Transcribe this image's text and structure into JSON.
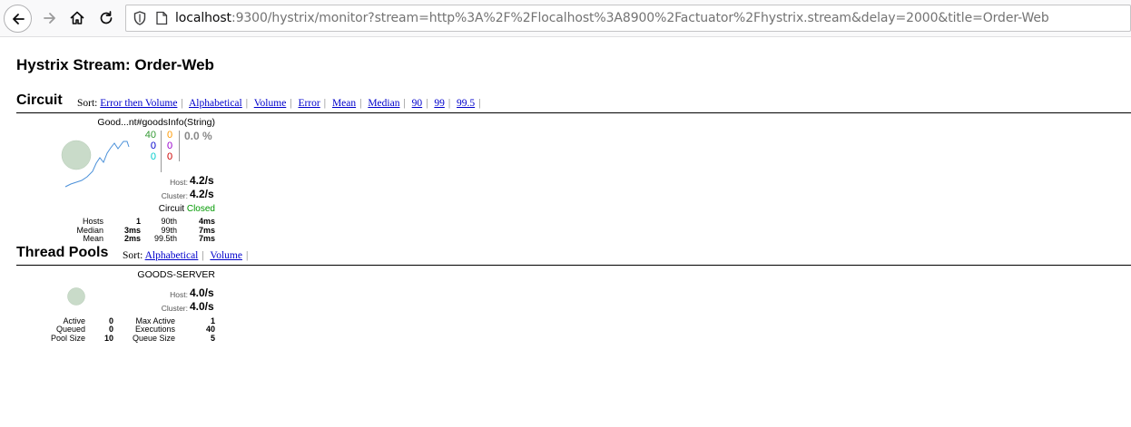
{
  "browser": {
    "url_host": "localhost",
    "url_rest": ":9300/hystrix/monitor?stream=http%3A%2F%2Flocalhost%3A8900%2Factuator%2Fhystrix.stream&delay=2000&title=Order-Web"
  },
  "page": {
    "title": "Hystrix Stream: Order-Web"
  },
  "circuit_section": {
    "title": "Circuit",
    "sort_label": "Sort:",
    "sort_options": [
      "Error then Volume",
      "Alphabetical",
      "Volume",
      "Error",
      "Mean",
      "Median",
      "90",
      "99",
      "99.5"
    ]
  },
  "circuit": {
    "name": "Good...nt#goodsInfo(String)",
    "success": "40",
    "short_circuited": "0",
    "bad_request": "0",
    "timeout": "0",
    "rejected": "0",
    "failure": "0",
    "error_pct": "0.0 %",
    "host_label": "Host:",
    "host_rate": "4.2/s",
    "cluster_label": "Cluster:",
    "cluster_rate": "4.2/s",
    "circuit_label": "Circuit",
    "circuit_status": "Closed",
    "stats": {
      "hosts_label": "Hosts",
      "hosts": "1",
      "median_label": "Median",
      "median": "3ms",
      "mean_label": "Mean",
      "mean": "2ms",
      "p90_label": "90th",
      "p90": "4ms",
      "p99_label": "99th",
      "p99": "7ms",
      "p995_label": "99.5th",
      "p995": "7ms"
    },
    "colors": {
      "success": "#339933",
      "short": "#0000cc",
      "bad": "#00cccc",
      "timeout": "#ff9900",
      "rejected": "#9900cc",
      "failure": "#cc0000",
      "pct": "#888888",
      "closed": "#009900",
      "bubble": "#c9dbc9",
      "spark": "#4a90d9"
    }
  },
  "thread_section": {
    "title": "Thread Pools",
    "sort_label": "Sort:",
    "sort_options": [
      "Alphabetical",
      "Volume"
    ]
  },
  "thread_pool": {
    "name": "GOODS-SERVER",
    "host_label": "Host:",
    "host_rate": "4.0/s",
    "cluster_label": "Cluster:",
    "cluster_rate": "4.0/s",
    "active_label": "Active",
    "active": "0",
    "queued_label": "Queued",
    "queued": "0",
    "pool_size_label": "Pool Size",
    "pool_size": "10",
    "max_active_label": "Max Active",
    "max_active": "1",
    "executions_label": "Executions",
    "executions": "40",
    "queue_size_label": "Queue Size",
    "queue_size": "5"
  }
}
